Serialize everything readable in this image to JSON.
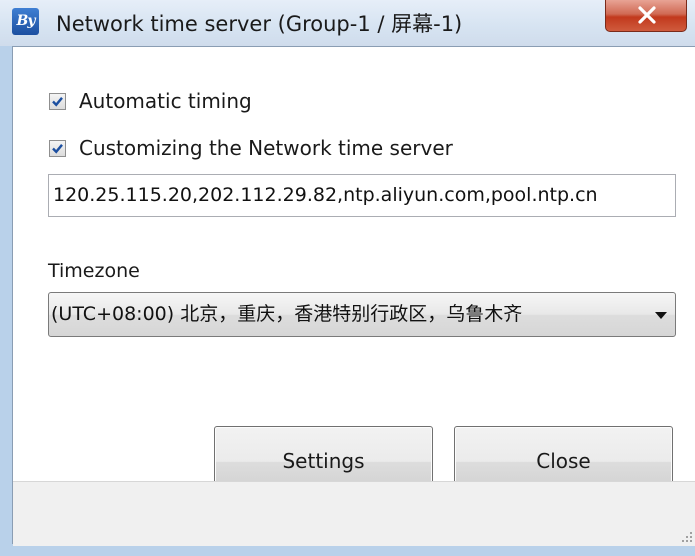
{
  "window": {
    "app_icon_text": "By",
    "title": "Network time server   (Group-1 / 屏幕-1)"
  },
  "options": {
    "automatic_timing": {
      "label": "Automatic timing",
      "checked": true
    },
    "custom_server": {
      "label": "Customizing the Network time server",
      "checked": true
    }
  },
  "server_field": {
    "value": "120.25.115.20,202.112.29.82,ntp.aliyun.com,pool.ntp.cn"
  },
  "timezone": {
    "label": "Timezone",
    "selected": "(UTC+08:00) 北京，重庆，香港特别行政区，乌鲁木齐"
  },
  "buttons": {
    "settings": "Settings",
    "close": "Close"
  },
  "colors": {
    "checkbox_mark": "#1c4fa0",
    "close_button": "#c2391d"
  }
}
